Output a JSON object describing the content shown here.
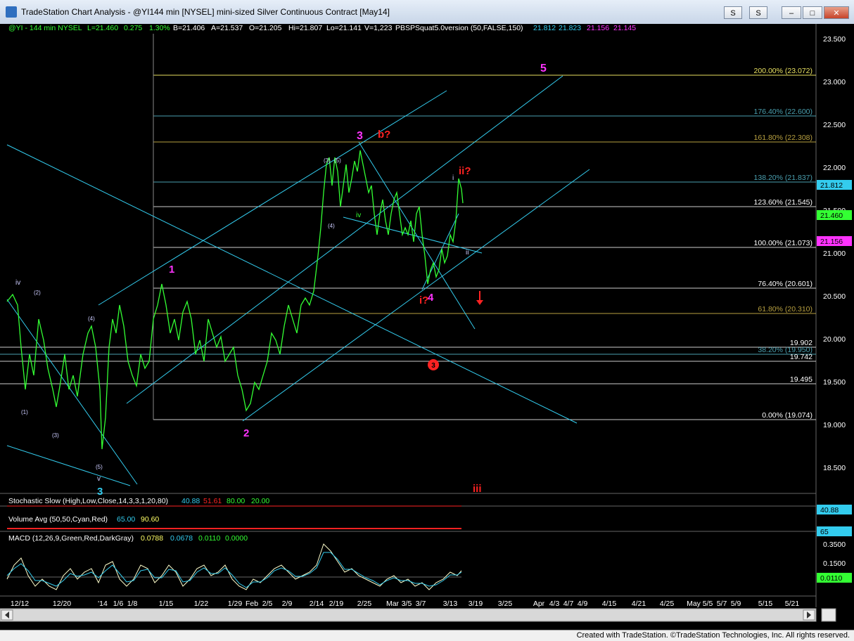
{
  "window": {
    "title": "TradeStation Chart Analysis - @YI144 min [NYSEL] mini-sized Silver Continuous Contract [May14]",
    "btn_s": "S",
    "btn_s2": "S",
    "btn_min": "–",
    "btn_max": "□",
    "btn_close": "✕"
  },
  "header": {
    "symbol": "@YI - 144 min  NYSEL",
    "last": "L=21.460",
    "change": "0.275",
    "pct": "1.30%",
    "bid": "B=21.406",
    "ask": "A=21.537",
    "open": "O=21.205",
    "high": "Hi=21.807",
    "low": "Lo=21.141",
    "vol": "V=1,223",
    "study": "PBSPSquat5.0version (50,FALSE,150)",
    "s1": "21.812",
    "s2": "21.823",
    "s3": "21.156",
    "s4": "21.145"
  },
  "price_axis": {
    "ticks": [
      "23.500",
      "23.000",
      "22.500",
      "22.000",
      "21.500",
      "21.000",
      "20.500",
      "20.000",
      "19.500",
      "19.000",
      "18.500"
    ]
  },
  "price_tags": {
    "t1": "21.812",
    "t2": "21.460",
    "t3": "21.156"
  },
  "fib_labels": {
    "f200": "200.00% (23.072)",
    "f176": "176.40% (22.600)",
    "f161": "161.80% (22.308)",
    "f138": "138.20% (21.837)",
    "f123": "123.60% (21.545)",
    "f100": "100.00% (21.073)",
    "f76": "76.40% (20.601)",
    "f61": "61.80% (20.310)",
    "f19902": "19.902",
    "f38": "38.20% (19.950)",
    "f19742": "19.742",
    "f19495": "19.495",
    "f0": "0.00% (19.074)"
  },
  "wave_labels": {
    "w1": "1",
    "w2": "2",
    "w3": "3",
    "w4": "4",
    "w5": "5",
    "b": "b?",
    "ii_q": "ii?",
    "i_q": "i?",
    "iii": "iii",
    "i": "i",
    "ii": "ii",
    "iv_mid": "iv",
    "iv_left": "iv",
    "v_left": "v",
    "c3": "3",
    "p1": "(1)",
    "p2": "(2)",
    "p3": "(3)",
    "p4": "(4)",
    "p5": "(5)",
    "p3b": "(3)",
    "p5b": "(5)",
    "p4b": "(4)",
    "circ3": "3"
  },
  "indicators": {
    "stoch": {
      "label": "Stochastic Slow (High,Low,Close,14,3,3,1,20,80)",
      "v1": "40.88",
      "v2": "51.61",
      "v3": "80.00",
      "v4": "20.00",
      "tag": "40.88"
    },
    "volume": {
      "label": "Volume Avg (50,50,Cyan,Red)",
      "v1": "65.00",
      "v2": "90.60",
      "tag": "65"
    },
    "macd": {
      "label": "MACD (12,26,9,Green,Red,DarkGray)",
      "v1": "0.0788",
      "v2": "0.0678",
      "v3": "0.0110",
      "v4": "0.0000",
      "tag": "0.0110",
      "ticks": [
        "0.3500",
        "0.1500"
      ]
    }
  },
  "date_axis": [
    "12/12",
    "12/20",
    "'14",
    "1/6",
    "1/8",
    "1/15",
    "1/22",
    "1/29",
    "Feb",
    "2/5",
    "2/9",
    "2/14",
    "2/19",
    "2/25",
    "Mar",
    "3/5",
    "3/7",
    "3/13",
    "3/19",
    "3/25",
    "Apr",
    "4/3",
    "4/7",
    "4/9",
    "4/15",
    "4/21",
    "4/25",
    "May",
    "5/5",
    "5/7",
    "5/9",
    "5/15",
    "5/21"
  ],
  "status": {
    "credit": "Created with TradeStation. ©TradeStation Technologies, Inc. All rights reserved."
  },
  "colors": {
    "price": "#33ff33",
    "channel": "#33ccee",
    "magenta": "#ff33ff",
    "red": "#ff2222",
    "fib_yellow": "#e8e060",
    "fib_grid": "#888888"
  }
}
